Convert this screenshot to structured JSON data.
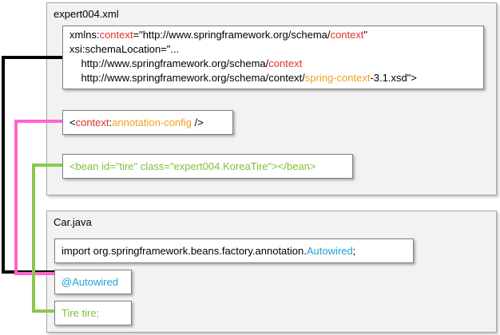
{
  "xml_panel": {
    "title": "expert004.xml",
    "namespace_box": {
      "line1": {
        "pre": "xmlns:",
        "red1": "context",
        "mid": "=\"http://www.springframework.org/schema/",
        "red2": "context",
        "post": "\""
      },
      "line2": {
        "text": "xsi:schemaLocation=\"..."
      },
      "line3": {
        "pre": "    http://www.springframework.org/schema/",
        "red": "context"
      },
      "line4": {
        "pre": "    http://www.springframework.org/schema/context/",
        "orange": "spring-context",
        "post": "-3.1.xsd\">"
      }
    },
    "annotation_box": {
      "pre": "<",
      "red": "context",
      "colon": ":",
      "orange": "annotation-config",
      "post": " />"
    },
    "bean_box": {
      "text": "<bean id=\"tire\" class=\"expert004.KoreaTire\"></bean>"
    }
  },
  "java_panel": {
    "title": "Car.java",
    "import_box": {
      "pre": "import org.springframework.beans.factory.annotation.",
      "blue": "Autowired",
      "post": ";"
    },
    "autowired_box": {
      "text": "@Autowired"
    },
    "field_box": {
      "text": "Tire tire;"
    }
  },
  "colors": {
    "black_connector": "#000000",
    "pink_connector": "#ff66cc",
    "green_connector": "#8cc84b",
    "red_text": "#e0302a",
    "orange_text": "#f0a020",
    "green_text": "#7fbf3a",
    "blue_text": "#1ea0d8"
  }
}
